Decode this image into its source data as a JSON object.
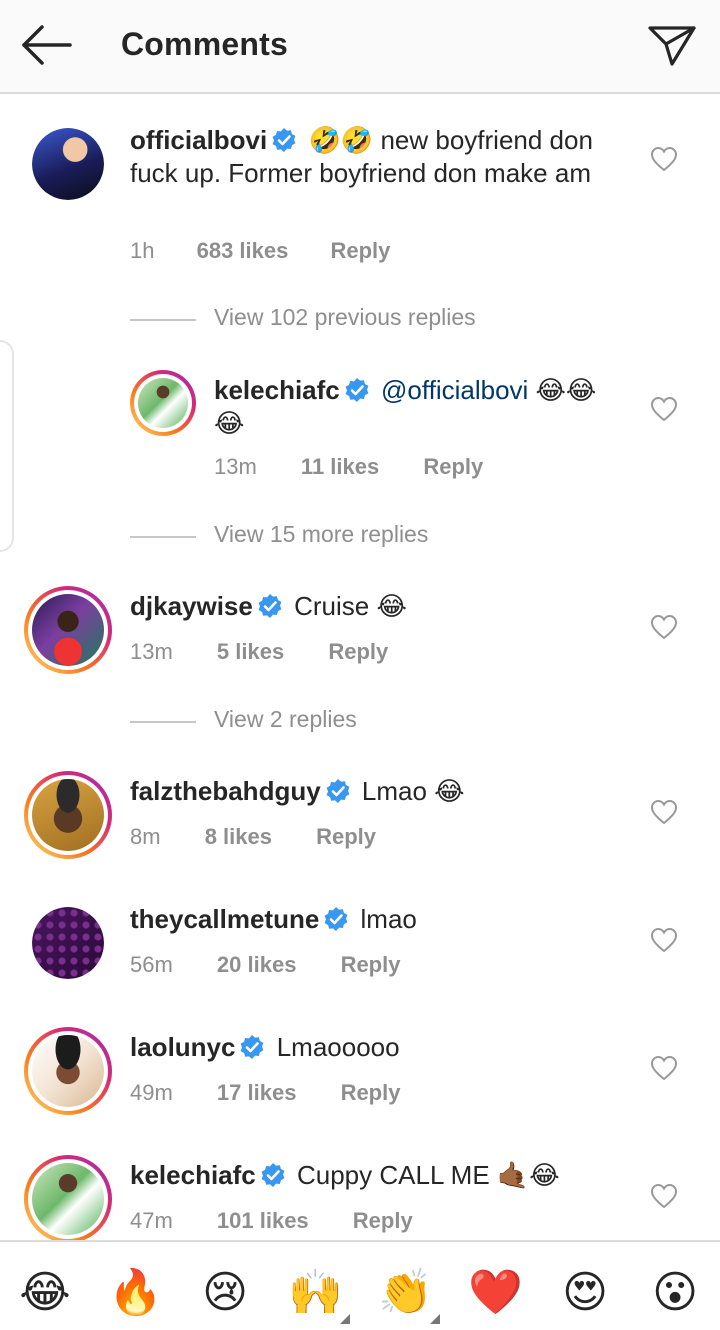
{
  "header": {
    "title": "Comments",
    "back_icon": "arrow-left-icon",
    "share_icon": "paper-plane-icon"
  },
  "comments": [
    {
      "username": "officialbovi",
      "verified": true,
      "text": "🤣🤣 new boyfriend don fuck up. Former boyfriend don make am",
      "time": "1h",
      "likes": "683 likes",
      "reply": "Reply"
    },
    {
      "username": "kelechiafc",
      "verified": true,
      "mention": "@officialbovi",
      "text": "😂😂😂",
      "time": "13m",
      "likes": "11 likes",
      "reply": "Reply"
    },
    {
      "username": "djkaywise",
      "verified": true,
      "text": "Cruise 😂",
      "time": "13m",
      "likes": "5 likes",
      "reply": "Reply"
    },
    {
      "username": "falzthebahdguy",
      "verified": true,
      "text": "Lmao 😂",
      "time": "8m",
      "likes": "8 likes",
      "reply": "Reply"
    },
    {
      "username": "theycallmetune",
      "verified": true,
      "text": "lmao",
      "time": "56m",
      "likes": "20 likes",
      "reply": "Reply"
    },
    {
      "username": "laolunyc",
      "verified": true,
      "text": "Lmaooooo",
      "time": "49m",
      "likes": "17 likes",
      "reply": "Reply"
    },
    {
      "username": "kelechiafc",
      "verified": true,
      "text": "Cuppy CALL ME 🤙🏾😂",
      "time": "47m",
      "likes": "101 likes",
      "reply": "Reply"
    }
  ],
  "view_replies": [
    "View 102 previous replies",
    "View 15 more replies",
    "View 2 replies"
  ],
  "emoji_bar": [
    "😂",
    "🔥",
    "😢",
    "🙌",
    "👏",
    "❤️",
    "😍",
    "😮"
  ],
  "colors": {
    "verified": "#3897f0",
    "meta": "#8e8e8e",
    "mention": "#00376b"
  }
}
